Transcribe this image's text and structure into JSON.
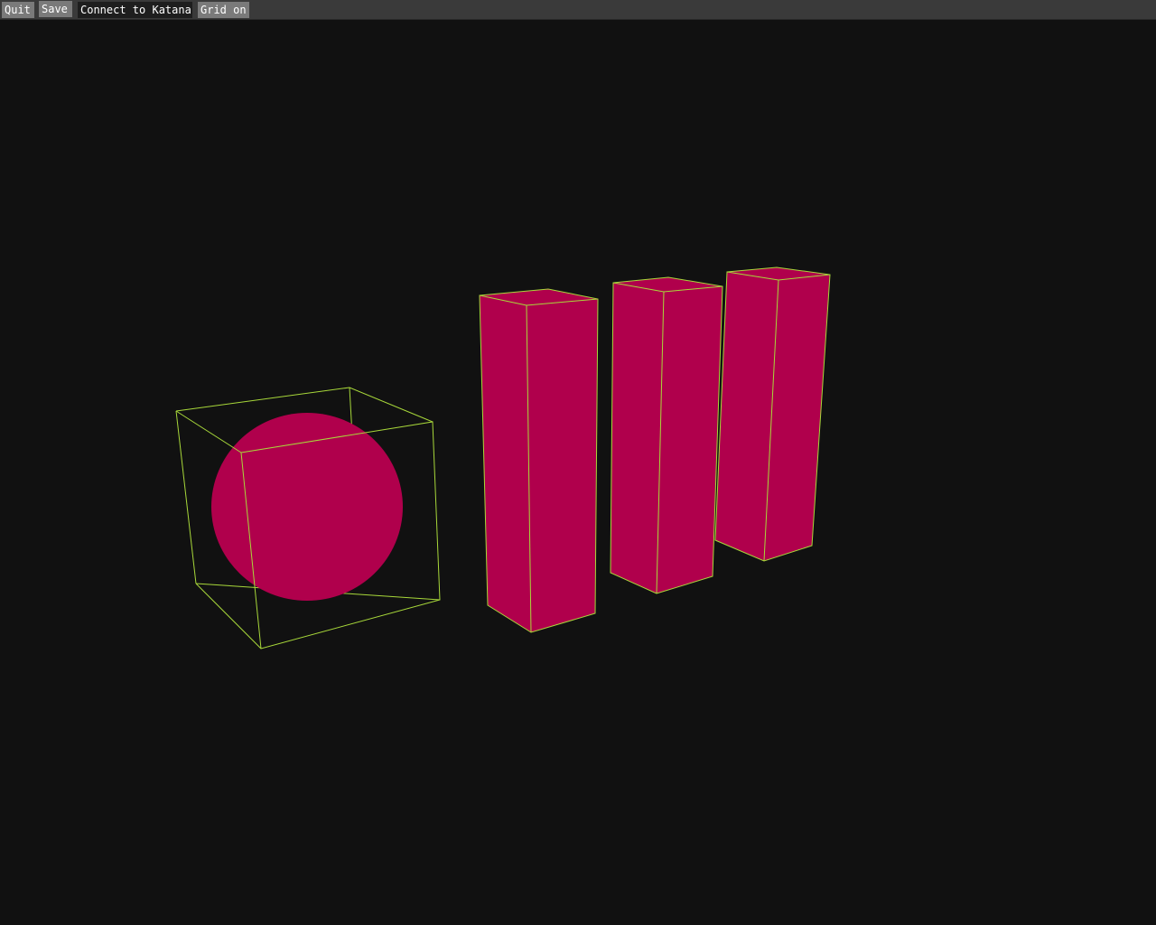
{
  "toolbar": {
    "quit_label": "Quit",
    "save_label": "Save",
    "connect_label": "Connect to Katana",
    "grid_label": "Grid on"
  },
  "viewport": {
    "background_color": "#111111",
    "object_color": "#b0004c",
    "wireframe_color": "#a8d83a",
    "objects": [
      "sphere",
      "box",
      "box",
      "box"
    ]
  }
}
